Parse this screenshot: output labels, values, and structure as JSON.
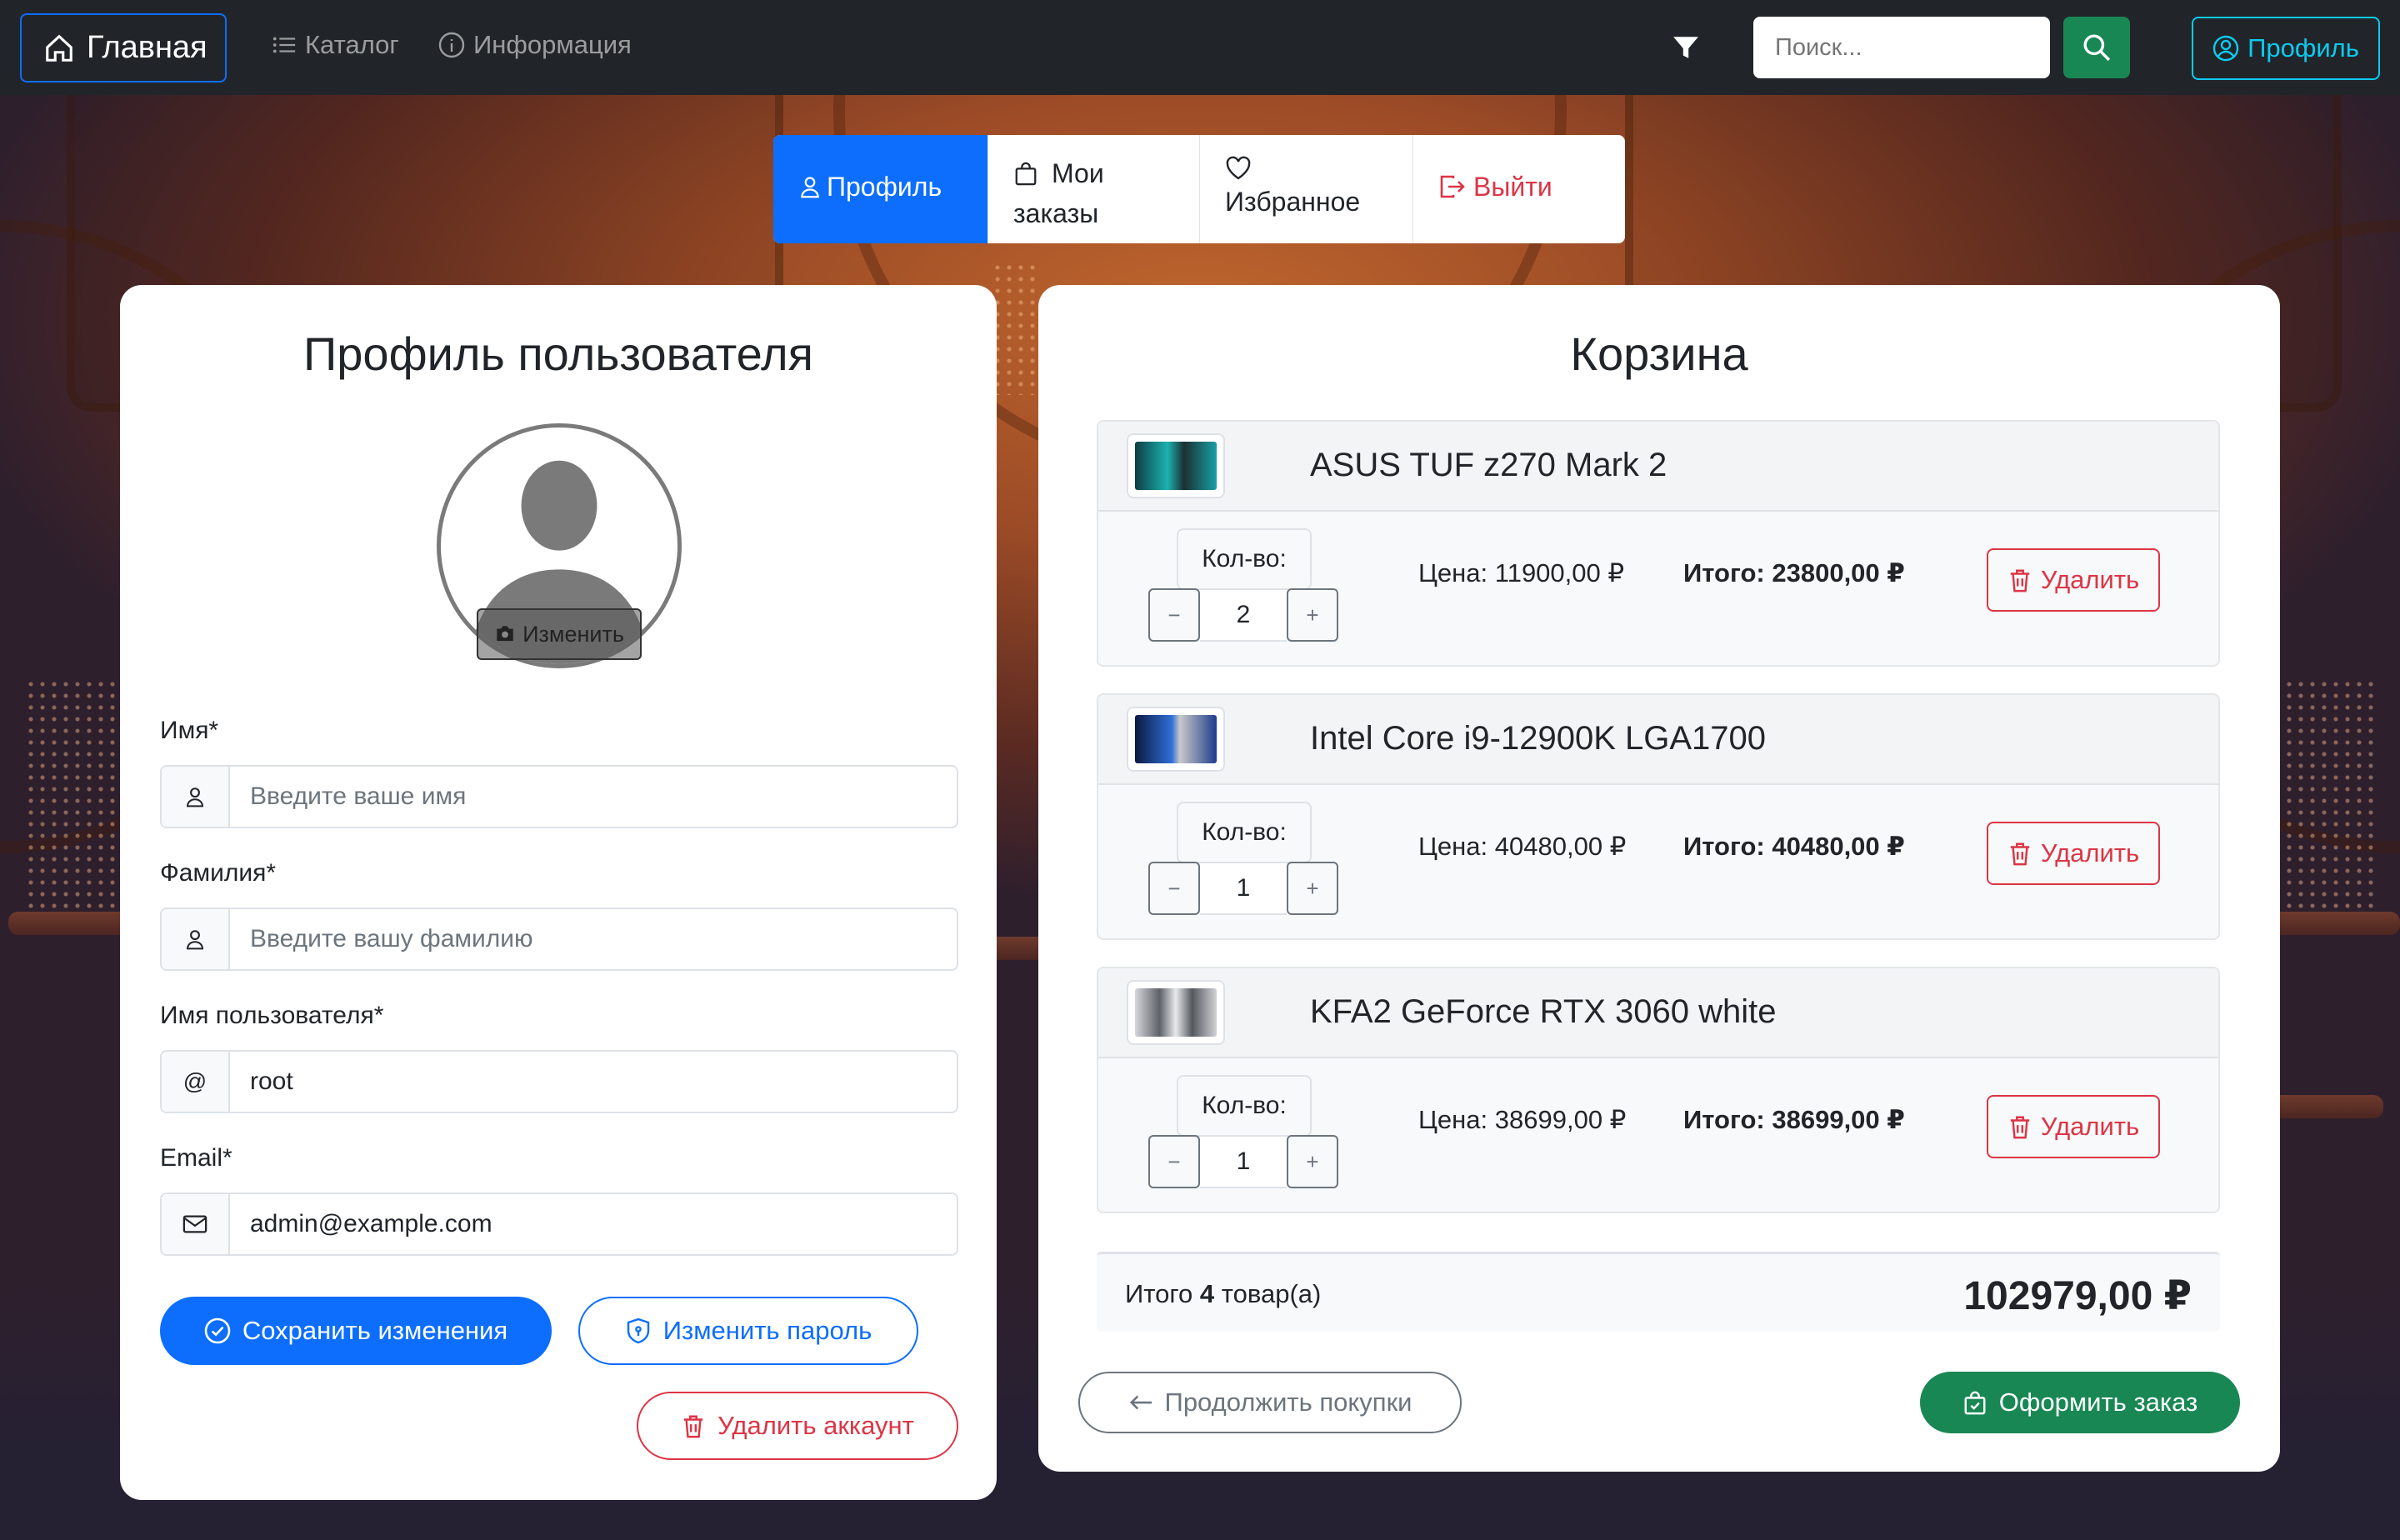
{
  "navbar": {
    "brand": "Главная",
    "links": [
      "Каталог",
      "Информация"
    ],
    "search_placeholder": "Поиск...",
    "profile": "Профиль"
  },
  "tabs": [
    {
      "label": "Профиль"
    },
    {
      "label": "Мои заказы"
    },
    {
      "label": "Избранное"
    },
    {
      "label": "Выйти"
    }
  ],
  "profile": {
    "title": "Профиль пользователя",
    "avatar_change": "Изменить",
    "fields": [
      {
        "label": "Имя*",
        "addon": "user",
        "value": "",
        "placeholder": "Введите ваше имя"
      },
      {
        "label": "Фамилия*",
        "addon": "user",
        "value": "",
        "placeholder": "Введите вашу фамилию"
      },
      {
        "label": "Имя пользователя*",
        "addon": "@",
        "value": "root",
        "placeholder": ""
      },
      {
        "label": "Email*",
        "addon": "mail",
        "value": "admin@example.com",
        "placeholder": ""
      }
    ],
    "save_btn": "Сохранить изменения",
    "change_password_btn": "Изменить пароль",
    "delete_account_btn": "Удалить аккаунт"
  },
  "cart": {
    "title": "Корзина",
    "qty_label": "Кол-во:",
    "delete_label": "Удалить",
    "items": [
      {
        "name": "ASUS TUF z270 Mark 2",
        "qty": "2",
        "price": "Цена: 11900,00 ₽",
        "total": "Итого: 23800,00 ₽",
        "thumb_color": "#1a9a9a"
      },
      {
        "name": "Intel Core i9-12900K LGA1700",
        "qty": "1",
        "price": "Цена: 40480,00 ₽",
        "total": "Итого: 40480,00 ₽",
        "thumb_color": "#2d5fb8"
      },
      {
        "name": "KFA2 GeForce RTX 3060 white",
        "qty": "1",
        "price": "Цена: 38699,00 ₽",
        "total": "Итого: 38699,00 ₽",
        "thumb_color": "#8a8f96"
      }
    ],
    "summary_prefix": "Итого",
    "summary_count": "4",
    "summary_suffix": "товар(а)",
    "grand_total": "102979,00 ₽",
    "continue_btn": "Продолжить покупки",
    "checkout_btn": "Оформить заказ"
  },
  "colors": {
    "primary": "#0d6efd",
    "success": "#198754",
    "danger": "#dc3545",
    "info": "#0dcaf0",
    "navbar": "#212529"
  }
}
